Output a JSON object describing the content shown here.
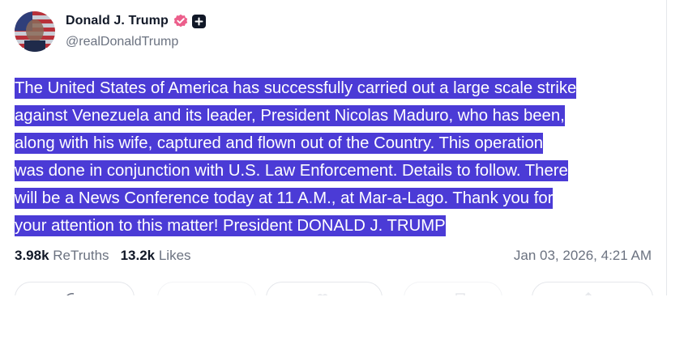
{
  "author": {
    "display_name": "Donald J. Trump",
    "handle": "@realDonaldTrump",
    "verified": true,
    "colors": {
      "verified_badge": "#ec5e8b",
      "plus_badge": "#111827"
    }
  },
  "post": {
    "lines": [
      "The United States of America has successfully carried out a large scale strike",
      "against Venezuela and its leader, President Nicolas Maduro, who has been,",
      "along with his wife, captured and flown out of the Country. This operation",
      "was done in conjunction with U.S. Law Enforcement. Details to follow. There",
      "will be a News Conference today at 11 A.M., at Mar-a-Lago. Thank you for",
      "your attention to this matter! President DONALD J. TRUMP"
    ],
    "selection_color": "#4b3bd6"
  },
  "stats": {
    "retruths_count": "3.98k",
    "retruths_label": "ReTruths",
    "likes_count": "13.2k",
    "likes_label": "Likes",
    "timestamp": "Jan 03, 2026, 4:21 AM"
  },
  "actions": {
    "icons": [
      "reply-icon",
      "retruth-icon",
      "like-icon",
      "bookmark-icon",
      "share-icon"
    ]
  }
}
